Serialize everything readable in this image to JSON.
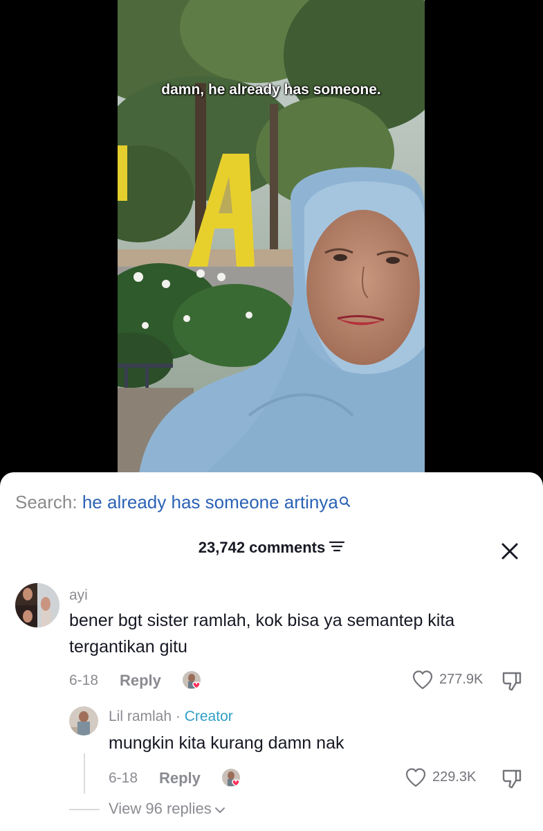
{
  "video": {
    "caption": "damn, he already has someone."
  },
  "search": {
    "prefix": "Search:",
    "query": "he already has someone artinya",
    "icon": "search-icon"
  },
  "comments_header": {
    "count": "23,742 comments",
    "filter_icon": "filter-icon",
    "close_icon": "close-icon"
  },
  "comment": {
    "username": "ayi",
    "text_line1": "bener bgt sister ramlah, kok bisa ya semantep kita",
    "text_line2": "tergantikan gitu",
    "date": "6-18",
    "reply_label": "Reply",
    "likes": "277.9K"
  },
  "reply": {
    "username": "Lil ramlah",
    "separator": " · ",
    "creator_label": "Creator",
    "text": "mungkin kita kurang damn nak",
    "date": "6-18",
    "reply_label": "Reply",
    "likes": "229.3K"
  },
  "view_replies": {
    "label": "View 96 replies"
  },
  "colors": {
    "search_query": "#2b62b5",
    "creator": "#2f9fc6",
    "like_heart_badge": "#fe2c55"
  }
}
